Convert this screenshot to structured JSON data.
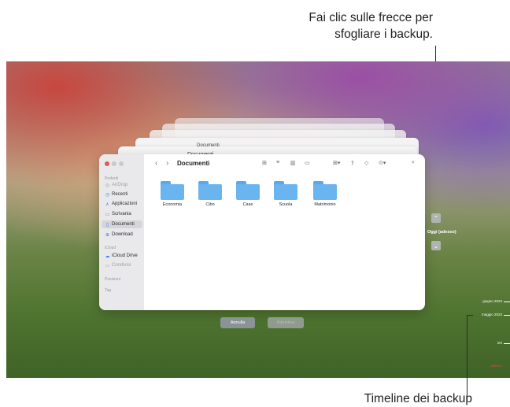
{
  "annotations": {
    "top_line1": "Fai clic sulle frecce per",
    "top_line2": "sfogliare i backup.",
    "bottom": "Timeline dei backup"
  },
  "stack": {
    "back_title_1": "Documenti",
    "back_title_2": "Documenti"
  },
  "finder": {
    "title": "Documenti",
    "sidebar": {
      "favorites_label": "Preferiti",
      "favorites": [
        {
          "label": "AirDrop",
          "icon": "airdrop-icon",
          "dim": true
        },
        {
          "label": "Recenti",
          "icon": "clock-icon"
        },
        {
          "label": "Applicazioni",
          "icon": "apps-icon"
        },
        {
          "label": "Scrivania",
          "icon": "desktop-icon"
        },
        {
          "label": "Documenti",
          "icon": "document-icon",
          "active": true
        },
        {
          "label": "Download",
          "icon": "download-icon"
        }
      ],
      "icloud_label": "iCloud",
      "icloud": [
        {
          "label": "iCloud Drive",
          "icon": "cloud-icon"
        },
        {
          "label": "Condivisi",
          "icon": "shared-folder-icon",
          "dim": true
        }
      ],
      "locations_label": "Posizioni",
      "tags_label": "Tag"
    },
    "folders": [
      "Economia",
      "Cibo",
      "Case",
      "Scuola",
      "Matrimonio"
    ]
  },
  "buttons": {
    "cancel": "Annulla",
    "restore": "Ripristina"
  },
  "timeline": {
    "now_label": "Oggi (adesso)",
    "marks": [
      "giugno 2023",
      "maggio 2023",
      "ieri",
      "adesso"
    ]
  },
  "colors": {
    "folder": "#6ab4f0",
    "accent": "#2f7df6",
    "close_red": "#e9544b"
  }
}
